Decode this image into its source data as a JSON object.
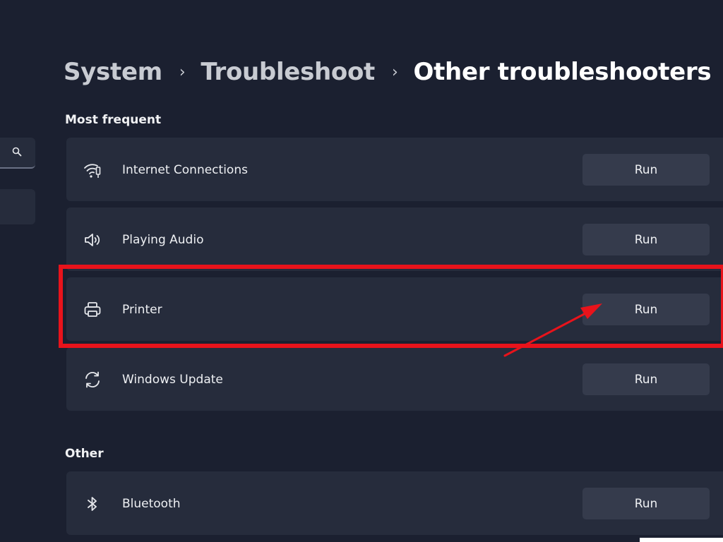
{
  "breadcrumb": {
    "items": [
      "System",
      "Troubleshoot",
      "Other troubleshooters"
    ],
    "separator": "›"
  },
  "sections": {
    "most_frequent": {
      "heading": "Most frequent",
      "items": [
        {
          "label": "Internet Connections",
          "icon": "wifi-icon",
          "button": "Run"
        },
        {
          "label": "Playing Audio",
          "icon": "speaker-icon",
          "button": "Run"
        },
        {
          "label": "Printer",
          "icon": "printer-icon",
          "button": "Run"
        },
        {
          "label": "Windows Update",
          "icon": "sync-icon",
          "button": "Run"
        }
      ]
    },
    "other": {
      "heading": "Other",
      "items": [
        {
          "label": "Bluetooth",
          "icon": "bluetooth-icon",
          "button": "Run"
        }
      ]
    }
  },
  "annotation": {
    "highlight_color": "#e8131b",
    "highlighted_item": "Printer"
  },
  "colors": {
    "background": "#1b2030",
    "card": "#262c3c",
    "button": "#353b4c"
  }
}
